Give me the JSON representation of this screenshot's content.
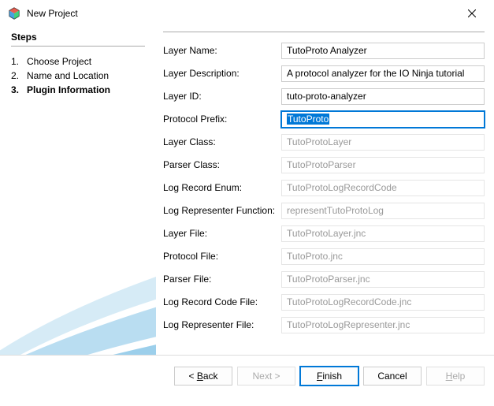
{
  "window": {
    "title": "New Project"
  },
  "sidebar": {
    "heading": "Steps",
    "steps": [
      {
        "num": "1.",
        "label": "Choose Project"
      },
      {
        "num": "2.",
        "label": "Name and Location"
      },
      {
        "num": "3.",
        "label": "Plugin Information"
      }
    ]
  },
  "form": {
    "layerName": {
      "label": "Layer Name:",
      "value": "TutoProto Analyzer"
    },
    "layerDescription": {
      "label": "Layer Description:",
      "value": "A protocol analyzer for the IO Ninja tutorial"
    },
    "layerId": {
      "label": "Layer ID:",
      "value": "tuto-proto-analyzer"
    },
    "protocolPrefix": {
      "label": "Protocol Prefix:",
      "value": "TutoProto"
    },
    "layerClass": {
      "label": "Layer Class:",
      "value": "TutoProtoLayer"
    },
    "parserClass": {
      "label": "Parser Class:",
      "value": "TutoProtoParser"
    },
    "logRecordEnum": {
      "label": "Log Record Enum:",
      "value": "TutoProtoLogRecordCode"
    },
    "logRepresenterFn": {
      "label": "Log Representer Function:",
      "value": "representTutoProtoLog"
    },
    "layerFile": {
      "label": "Layer File:",
      "value": "TutoProtoLayer.jnc"
    },
    "protocolFile": {
      "label": "Protocol File:",
      "value": "TutoProto.jnc"
    },
    "parserFile": {
      "label": "Parser File:",
      "value": "TutoProtoParser.jnc"
    },
    "logRecordCodeFile": {
      "label": "Log Record Code File:",
      "value": "TutoProtoLogRecordCode.jnc"
    },
    "logRepresenterFile": {
      "label": "Log Representer File:",
      "value": "TutoProtoLogRepresenter.jnc"
    }
  },
  "footer": {
    "back": "Back",
    "next": "Next >",
    "finish": "Finish",
    "cancel": "Cancel",
    "help": "Help"
  }
}
